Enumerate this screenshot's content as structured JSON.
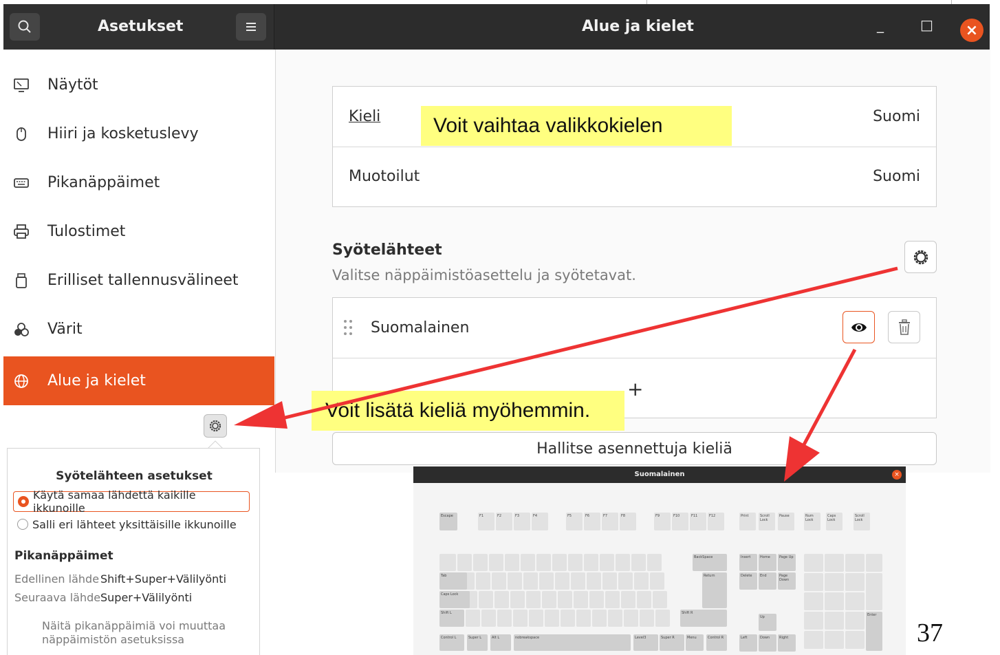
{
  "window": {
    "sidebar_title": "Asetukset",
    "panel_title": "Alue ja kielet",
    "minimize_glyph": "_",
    "maximize_glyph": "□",
    "close_glyph": "×"
  },
  "sidebar": {
    "items": [
      {
        "label": "Näytöt",
        "icon": "display-icon"
      },
      {
        "label": "Hiiri ja kosketuslevy",
        "icon": "mouse-icon"
      },
      {
        "label": "Pikanäppäimet",
        "icon": "keyboard-icon"
      },
      {
        "label": "Tulostimet",
        "icon": "printer-icon"
      },
      {
        "label": "Erilliset tallennusvälineet",
        "icon": "removable-media-icon"
      },
      {
        "label": "Värit",
        "icon": "color-icon"
      },
      {
        "label": "Alue ja kielet",
        "icon": "globe-icon",
        "active": true
      }
    ]
  },
  "language": {
    "kieli_label": "Kieli",
    "kieli_value": "Suomi",
    "muotoilut_label": "Muotoilut",
    "muotoilut_value": "Suomi"
  },
  "input_sources": {
    "title": "Syötelähteet",
    "subtitle": "Valitse näppäimistöasettelu ja syötetavat.",
    "items": [
      {
        "label": "Suomalainen"
      }
    ],
    "add_glyph": "+",
    "manage_button": "Hallitse asennettuja kieliä"
  },
  "callouts": {
    "menu_language": "Voit vaihtaa valikkokielen",
    "add_languages": "Voit lisätä kieliä myöhemmin."
  },
  "popover": {
    "title": "Syötelähteen asetukset",
    "option_same": "Käytä samaa lähdettä kaikille ikkunoille",
    "option_separate": "Salli eri lähteet yksittäisille ikkunoille",
    "selected": "same",
    "shortcuts_title": "Pikanäppäimet",
    "prev_label": "Edellinen lähde",
    "prev_value": "Shift+Super+Välilyönti",
    "next_label": "Seuraava lähde",
    "next_value": "Super+Välilyönti",
    "note_line1": "Näitä pikanäppäimiä voi muuttaa",
    "note_line2": "näppäimistön asetuksissa"
  },
  "keyboard_preview": {
    "title": "Suomalainen",
    "fn_row": [
      "Escape",
      "F1",
      "F2",
      "F3",
      "F4",
      "F5",
      "F6",
      "F7",
      "F8",
      "F9",
      "F10",
      "F11",
      "F12",
      "Print",
      "Scroll Lock",
      "Pause",
      "Num Lock",
      "Caps Lock",
      "Scroll Lock"
    ],
    "modifier_labels": [
      "Tab",
      "Caps Lock",
      "Shift L",
      "Control L",
      "Super L",
      "Alt L",
      "nobreakspace",
      "Level3",
      "Super R",
      "Menu",
      "Control R",
      "BackSpace",
      "Return",
      "Shift R",
      "Insert",
      "Home",
      "Page Up",
      "Delete",
      "End",
      "Page Down",
      "Up",
      "Left",
      "Down",
      "Right",
      "Enter"
    ]
  },
  "page_number": "37",
  "colors": {
    "accent": "#e95420",
    "headerbar": "#2c2c2c",
    "callout": "#ffff80",
    "arrow": "#ee3333"
  }
}
